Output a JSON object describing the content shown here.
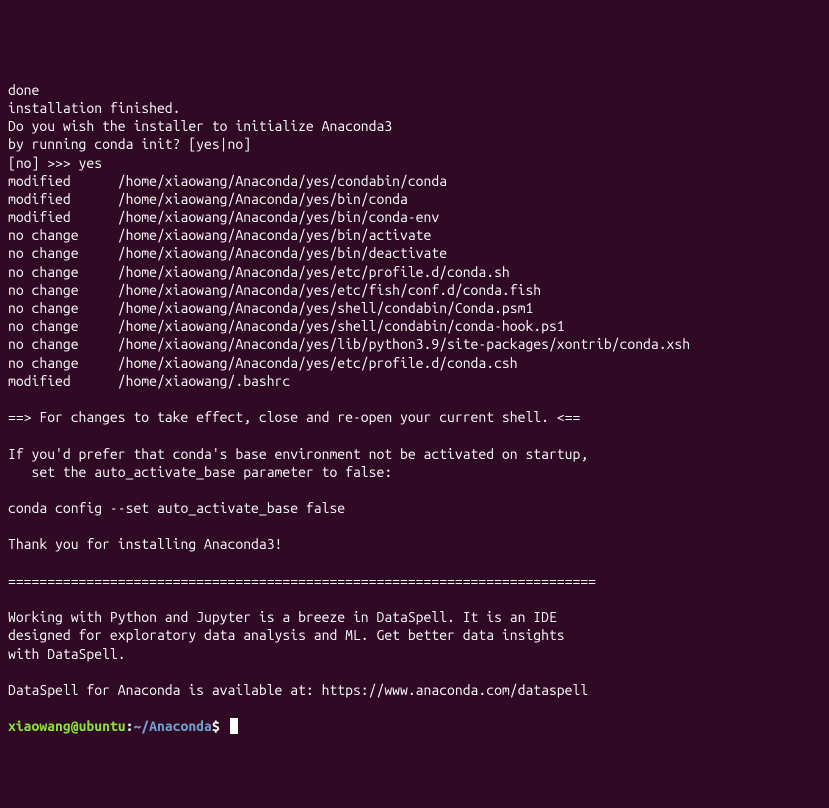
{
  "lines": [
    "done",
    "installation finished.",
    "Do you wish the installer to initialize Anaconda3",
    "by running conda init? [yes|no]",
    "[no] >>> yes",
    "modified      /home/xiaowang/Anaconda/yes/condabin/conda",
    "modified      /home/xiaowang/Anaconda/yes/bin/conda",
    "modified      /home/xiaowang/Anaconda/yes/bin/conda-env",
    "no change     /home/xiaowang/Anaconda/yes/bin/activate",
    "no change     /home/xiaowang/Anaconda/yes/bin/deactivate",
    "no change     /home/xiaowang/Anaconda/yes/etc/profile.d/conda.sh",
    "no change     /home/xiaowang/Anaconda/yes/etc/fish/conf.d/conda.fish",
    "no change     /home/xiaowang/Anaconda/yes/shell/condabin/Conda.psm1",
    "no change     /home/xiaowang/Anaconda/yes/shell/condabin/conda-hook.ps1",
    "no change     /home/xiaowang/Anaconda/yes/lib/python3.9/site-packages/xontrib/conda.xsh",
    "no change     /home/xiaowang/Anaconda/yes/etc/profile.d/conda.csh",
    "modified      /home/xiaowang/.bashrc",
    "",
    "==> For changes to take effect, close and re-open your current shell. <==",
    "",
    "If you'd prefer that conda's base environment not be activated on startup, ",
    "   set the auto_activate_base parameter to false: ",
    "",
    "conda config --set auto_activate_base false",
    "",
    "Thank you for installing Anaconda3!",
    "",
    "===========================================================================",
    "",
    "Working with Python and Jupyter is a breeze in DataSpell. It is an IDE",
    "designed for exploratory data analysis and ML. Get better data insights",
    "with DataSpell.",
    "",
    "DataSpell for Anaconda is available at: https://www.anaconda.com/dataspell",
    ""
  ],
  "prompt": {
    "user": "xiaowang",
    "at": "@",
    "host": "ubuntu",
    "colon": ":",
    "path": "~/Anaconda",
    "dollar": "$"
  }
}
